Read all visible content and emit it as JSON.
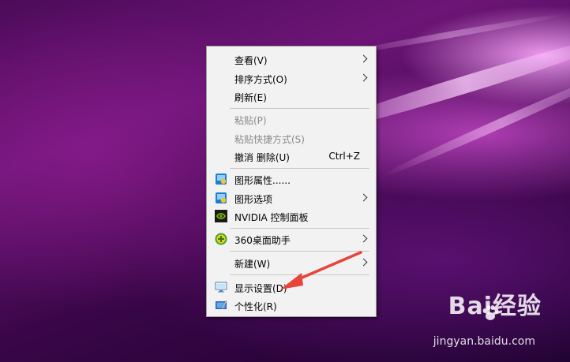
{
  "menu": {
    "items": [
      {
        "label": "查看(V)",
        "submenu": true
      },
      {
        "label": "排序方式(O)",
        "submenu": true
      },
      {
        "label": "刷新(E)"
      },
      {
        "label": "粘贴(P)",
        "disabled": true
      },
      {
        "label": "粘贴快捷方式(S)",
        "disabled": true
      },
      {
        "label": "撤消 删除(U)",
        "shortcut": "Ctrl+Z"
      },
      {
        "label": "图形属性......",
        "icon": "intel-graphics-icon"
      },
      {
        "label": "图形选项",
        "icon": "intel-graphics-icon",
        "submenu": true
      },
      {
        "label": "NVIDIA 控制面板",
        "icon": "nvidia-icon"
      },
      {
        "label": "360桌面助手",
        "icon": "360-icon",
        "submenu": true
      },
      {
        "label": "新建(W)",
        "submenu": true
      },
      {
        "label": "显示设置(D)",
        "icon": "display-settings-icon"
      },
      {
        "label": "个性化(R)",
        "icon": "personalize-icon"
      }
    ]
  },
  "watermark": {
    "brand": "Bai经验",
    "site": "jingyan.baidu.com"
  },
  "colors": {
    "menu_bg": "#f2f2f2",
    "annotation_arrow": "#e8443a",
    "disabled_text": "#8a8a8a"
  }
}
